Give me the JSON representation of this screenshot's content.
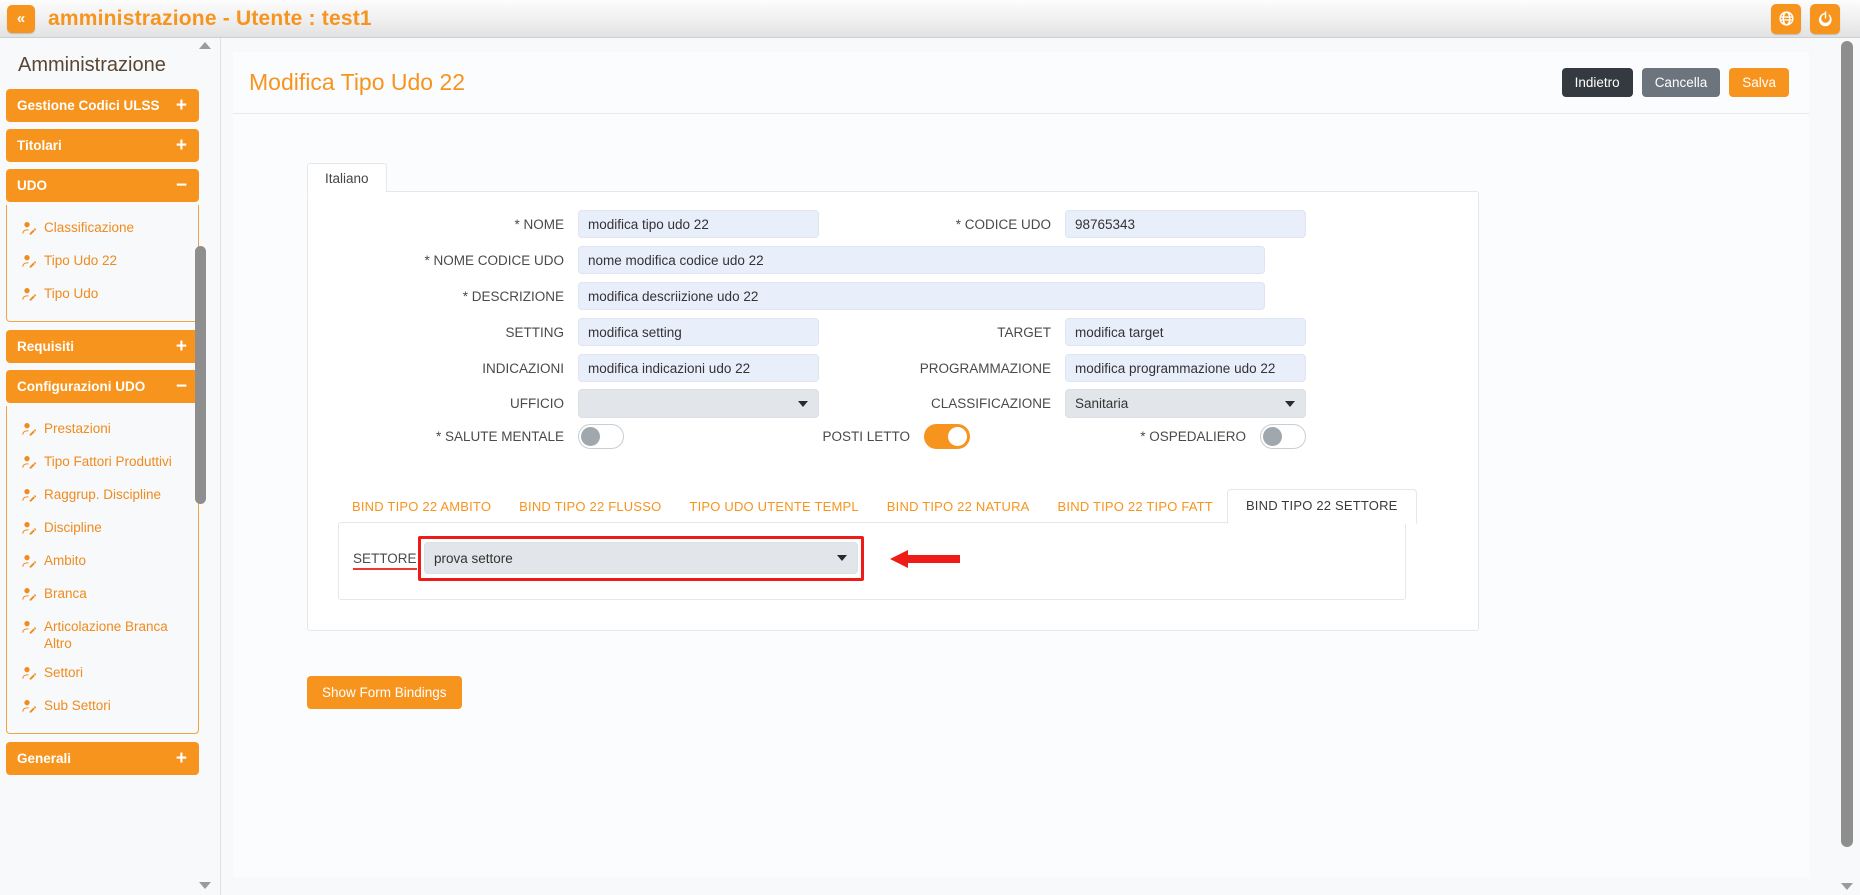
{
  "topbar": {
    "collapse_label": "«",
    "title": "amministrazione - Utente : test1",
    "icons": [
      {
        "name": "globe-icon"
      },
      {
        "name": "power-icon"
      }
    ]
  },
  "sidebar": {
    "title": "Amministrazione",
    "groups": [
      {
        "label": "Gestione Codici ULSS",
        "toggle": "+",
        "expanded": false,
        "items": []
      },
      {
        "label": "Titolari",
        "toggle": "+",
        "expanded": false,
        "items": []
      },
      {
        "label": "UDO",
        "toggle": "−",
        "expanded": true,
        "items": [
          "Classificazione",
          "Tipo Udo 22",
          "Tipo Udo"
        ]
      },
      {
        "label": "Requisiti",
        "toggle": "+",
        "expanded": false,
        "items": []
      },
      {
        "label": "Configurazioni UDO",
        "toggle": "−",
        "expanded": true,
        "items": [
          "Prestazioni",
          "Tipo Fattori Produttivi",
          "Raggrup. Discipline",
          "Discipline",
          "Ambito",
          "Branca",
          "Articolazione Branca Altro",
          "Settori",
          "Sub Settori"
        ]
      },
      {
        "label": "Generali",
        "toggle": "+",
        "expanded": false,
        "items": []
      }
    ]
  },
  "page": {
    "title": "Modifica Tipo Udo 22",
    "actions": [
      {
        "label": "Indietro",
        "style": "dark"
      },
      {
        "label": "Cancella",
        "style": "grey"
      },
      {
        "label": "Salva",
        "style": "orange"
      }
    ]
  },
  "form": {
    "lang_tab": "Italiano",
    "fields": {
      "nome": {
        "label": "* NOME",
        "value": "modifica tipo udo 22"
      },
      "codice_udo": {
        "label": "* CODICE UDO",
        "value": "98765343"
      },
      "nome_codice_udo": {
        "label": "* NOME CODICE UDO",
        "value": "nome modifica codice udo 22"
      },
      "descrizione": {
        "label": "* DESCRIZIONE",
        "value": "modifica descriizione udo 22"
      },
      "setting": {
        "label": "SETTING",
        "value": "modifica setting"
      },
      "target": {
        "label": "TARGET",
        "value": "modifica target"
      },
      "indicazioni": {
        "label": "INDICAZIONI",
        "value": "modifica indicazioni udo 22"
      },
      "programmazione": {
        "label": "PROGRAMMAZIONE",
        "value": "modifica programmazione udo 22"
      },
      "ufficio": {
        "label": "UFFICIO",
        "value": ""
      },
      "classificazione": {
        "label": "CLASSIFICAZIONE",
        "value": "Sanitaria"
      },
      "salute_mentale": {
        "label": "* SALUTE MENTALE",
        "value": "off"
      },
      "posti_letto": {
        "label": "POSTI LETTO",
        "value": "on"
      },
      "ospedaliero": {
        "label": "* OSPEDALIERO",
        "value": "off"
      }
    }
  },
  "bind_tabs": [
    {
      "label": "BIND TIPO 22 AMBITO",
      "active": false
    },
    {
      "label": "BIND TIPO 22 FLUSSO",
      "active": false
    },
    {
      "label": "TIPO UDO UTENTE TEMPL",
      "active": false
    },
    {
      "label": "BIND TIPO 22 NATURA",
      "active": false
    },
    {
      "label": "BIND TIPO 22 TIPO FATT",
      "active": false
    },
    {
      "label": "BIND TIPO 22 SETTORE",
      "active": true
    }
  ],
  "bind_panel": {
    "settore_label": "SETTORE",
    "settore_value": "prova settore"
  },
  "footer": {
    "show_bindings_label": "Show Form Bindings"
  },
  "colors": {
    "accent": "#f7941e",
    "highlight": "#ee1b17",
    "input_bg": "#e9eefb",
    "select_bg": "#e2e6ea"
  }
}
